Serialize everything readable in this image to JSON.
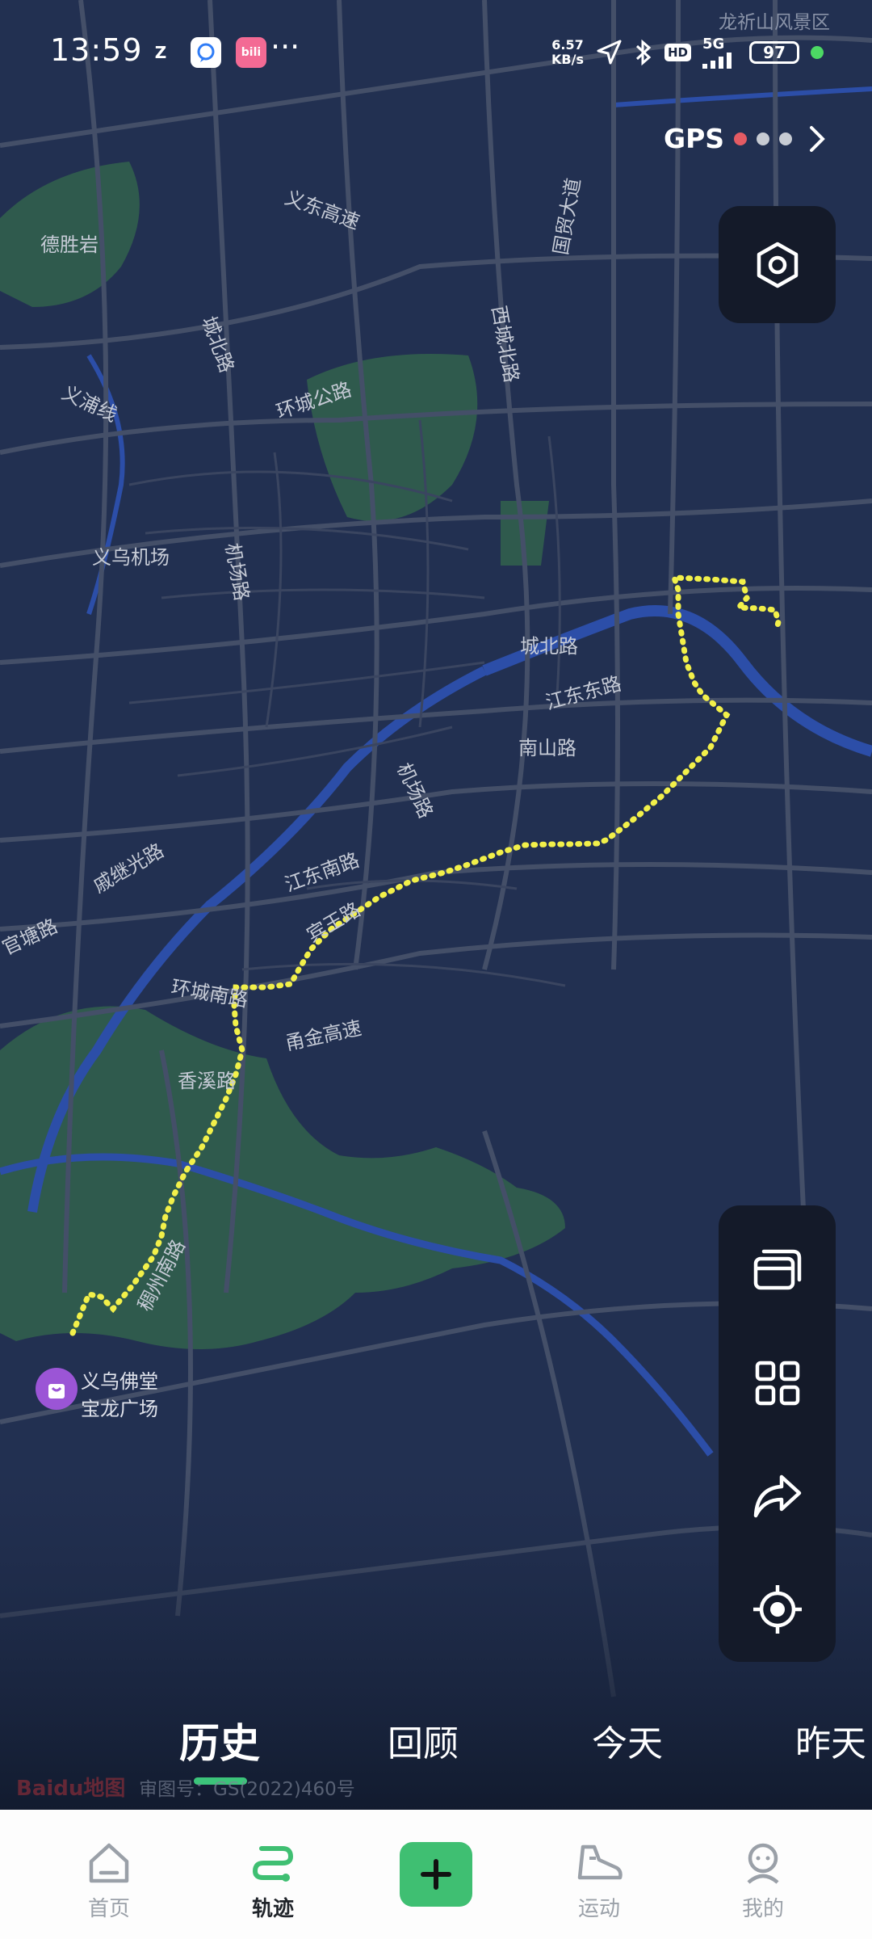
{
  "status_bar": {
    "time": "13:59",
    "net_speed_value": "6.57",
    "net_speed_unit": "KB/s",
    "hd_badge": "HD",
    "network": "5G",
    "battery": "97",
    "more": "···",
    "app_icons": [
      "zhifubao-icon",
      "chat-bubble-icon",
      "bilibili-icon"
    ]
  },
  "map_watermark_scenic": "龙祈山风景区",
  "gps": {
    "label": "GPS",
    "dot_colors": [
      "#e45b63",
      "#c7cbd3",
      "#c7cbd3"
    ]
  },
  "map_labels": [
    {
      "key": "desheng",
      "text": "德胜岩"
    },
    {
      "key": "yipu",
      "text": "义浦线"
    },
    {
      "key": "airport",
      "text": "义乌机场"
    },
    {
      "key": "yidong",
      "text": "义东高速"
    },
    {
      "key": "huancheng_gong",
      "text": "环城公路"
    },
    {
      "key": "chengbei_w",
      "text": "城北路"
    },
    {
      "key": "xicheng_bei",
      "text": "西城北路"
    },
    {
      "key": "guomao",
      "text": "国贸大道"
    },
    {
      "key": "jichang",
      "text": "机场路"
    },
    {
      "key": "chengbei",
      "text": "城北路"
    },
    {
      "key": "jiangdong_dong",
      "text": "江东东路"
    },
    {
      "key": "nanshan",
      "text": "南山路"
    },
    {
      "key": "jichang2",
      "text": "机场路"
    },
    {
      "key": "qijiguang",
      "text": "戚继光路"
    },
    {
      "key": "jiangdong_nan",
      "text": "江东南路"
    },
    {
      "key": "guantang",
      "text": "官塘路"
    },
    {
      "key": "huancheng_nan",
      "text": "环城南路"
    },
    {
      "key": "nanjin",
      "text": "甬金高速"
    },
    {
      "key": "xiangxi",
      "text": "香溪路"
    },
    {
      "key": "binwang",
      "text": "宾王路"
    },
    {
      "key": "zhenghe",
      "text": "稠州南路"
    }
  ],
  "poi": {
    "line1": "义乌佛堂",
    "line2": "宝龙广场"
  },
  "tabs": [
    {
      "label": "历史",
      "active": true
    },
    {
      "label": "回顾",
      "active": false
    },
    {
      "label": "今天",
      "active": false
    },
    {
      "label": "昨天",
      "active": false
    }
  ],
  "map_attribution": {
    "brand": "Baidu地图",
    "license": "审图号：GS(2022)460号"
  },
  "side_tools": [
    "layers-icon",
    "grid-icon",
    "share-icon",
    "locate-icon"
  ],
  "bottom_nav": [
    {
      "label": "首页",
      "icon": "home-icon",
      "active": false
    },
    {
      "label": "轨迹",
      "icon": "track-icon",
      "active": true
    },
    {
      "label": "运动",
      "icon": "sneaker-icon",
      "active": false
    },
    {
      "label": "我的",
      "icon": "profile-icon",
      "active": false
    }
  ],
  "colors": {
    "track": "#f2f04a",
    "accent": "#3fbf72",
    "map_bg": "#202c47",
    "park": "#2f5a4d",
    "water": "#2c4ea8"
  }
}
